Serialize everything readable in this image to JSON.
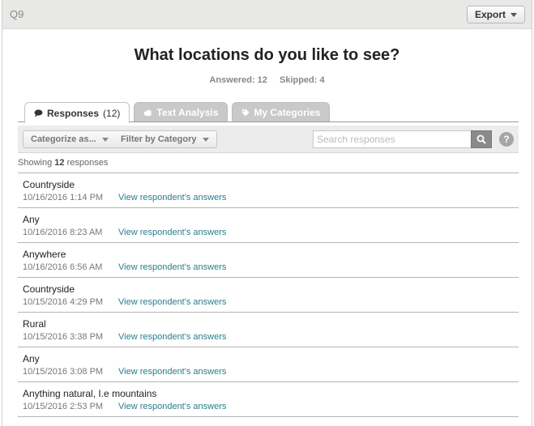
{
  "header": {
    "question_number": "Q9",
    "export_label": "Export"
  },
  "question": {
    "title": "What locations do you like to see?",
    "answered": "Answered: 12",
    "skipped": "Skipped: 4"
  },
  "tabs": [
    {
      "label": "Responses",
      "count": "(12)",
      "icon": "speech-bubble-icon",
      "active": true
    },
    {
      "label": "Text Analysis",
      "icon": "cloud-icon",
      "active": false
    },
    {
      "label": "My Categories",
      "icon": "tag-icon",
      "active": false
    }
  ],
  "toolbar": {
    "categorize_label": "Categorize as...",
    "filter_label": "Filter by Category",
    "search_placeholder": "Search responses",
    "help_label": "?"
  },
  "showing": {
    "prefix": "Showing",
    "count": "12",
    "suffix": "responses"
  },
  "link_label": "View respondent's answers",
  "responses": [
    {
      "text": "Countryside",
      "date": "10/16/2016 1:14 PM"
    },
    {
      "text": "Any",
      "date": "10/16/2016 8:23 AM"
    },
    {
      "text": "Anywhere",
      "date": "10/16/2016 6:56 AM"
    },
    {
      "text": "Countryside",
      "date": "10/15/2016 4:29 PM"
    },
    {
      "text": "Rural",
      "date": "10/15/2016 3:38 PM"
    },
    {
      "text": "Any",
      "date": "10/15/2016 3:08 PM"
    },
    {
      "text": "Anything natural, I.e mountains",
      "date": "10/15/2016 2:53 PM"
    }
  ],
  "colors": {
    "link": "#2a7d8c",
    "topbar": "#e8e8e6",
    "inactive_tab": "#c9c9c9"
  }
}
